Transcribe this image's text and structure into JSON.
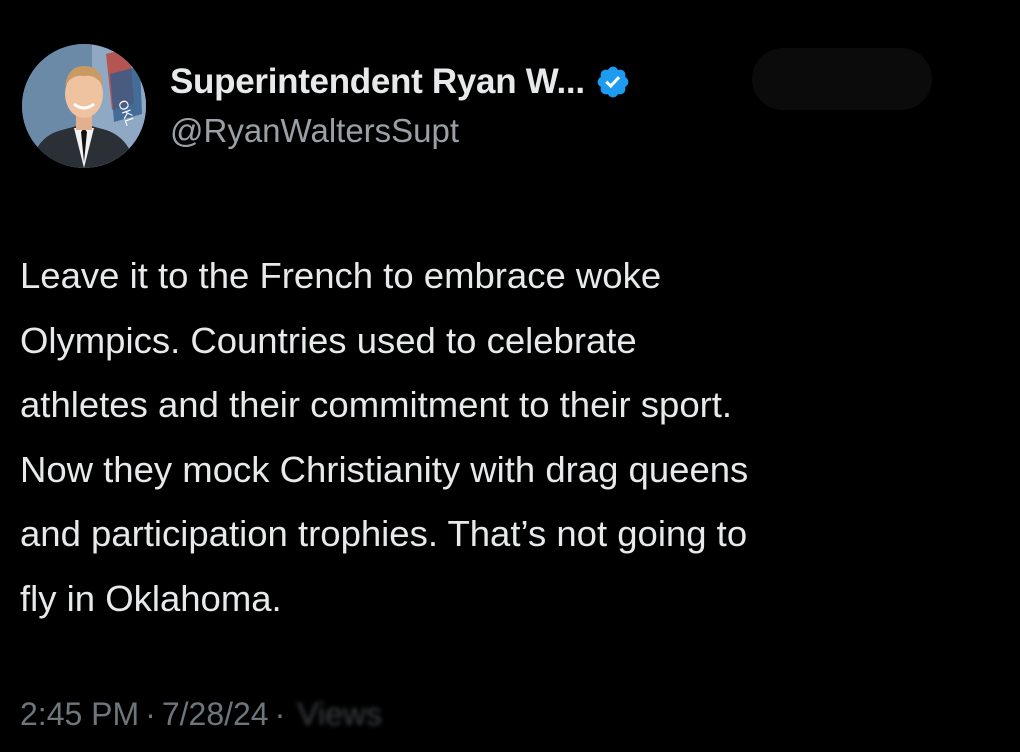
{
  "author": {
    "display_name": "Superintendent Ryan W...",
    "handle": "@RyanWaltersSupt",
    "verified": true
  },
  "tweet": {
    "text": "Leave it to the French to embrace woke\nOlympics.  Countries used to celebrate\nathletes and their commitment to their sport.\nNow they mock Christianity with drag queens\nand participation trophies.  That’s not going to\nfly in Oklahoma.",
    "time": "2:45 PM",
    "separator": "·",
    "date": "7/28/24",
    "views_label": "Views"
  },
  "colors": {
    "background": "#000000",
    "text": "#e7e9ea",
    "secondary": "#6e767d",
    "verified_blue": "#1d9bf0"
  },
  "icons": {
    "verified": "verified-badge-icon"
  }
}
